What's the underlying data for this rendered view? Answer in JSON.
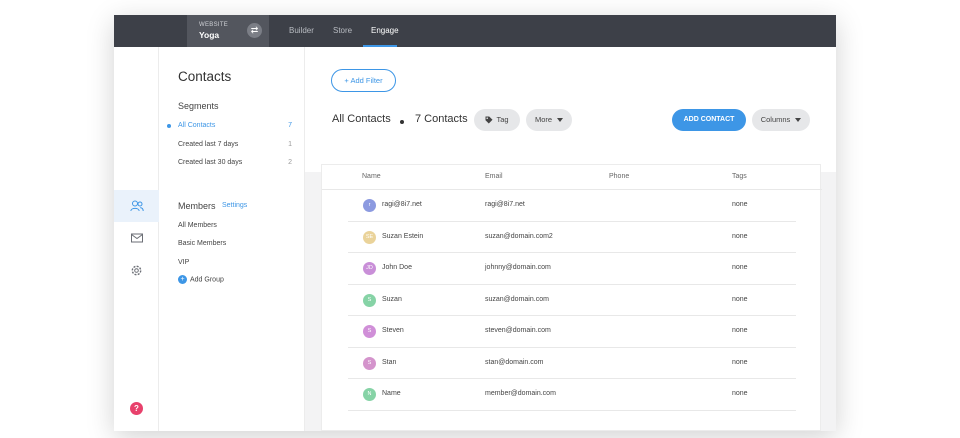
{
  "header": {
    "site_kicker": "WEBSITE",
    "site_name": "Yoga",
    "switch_icon": "swap-arrows-icon",
    "tabs": [
      {
        "label": "Builder",
        "active": false
      },
      {
        "label": "Store",
        "active": false
      },
      {
        "label": "Engage",
        "active": true
      }
    ]
  },
  "rail": {
    "items": [
      {
        "icon": "contacts-icon",
        "active": true
      },
      {
        "icon": "mail-icon",
        "active": false
      },
      {
        "icon": "gear-icon",
        "active": false
      }
    ],
    "help_label": "?"
  },
  "sidebar": {
    "title": "Contacts",
    "segments_heading": "Segments",
    "segments": [
      {
        "label": "All Contacts",
        "count": "7",
        "active": true
      },
      {
        "label": "Created last 7 days",
        "count": "1",
        "active": false
      },
      {
        "label": "Created last 30 days",
        "count": "2",
        "active": false
      }
    ],
    "members_heading": "Members",
    "settings_label": "Settings",
    "members": [
      {
        "label": "All Members"
      },
      {
        "label": "Basic Members"
      },
      {
        "label": "VIP"
      }
    ],
    "add_group_label": "Add Group"
  },
  "main": {
    "add_filter_label": "+ Add Filter",
    "heading": "All Contacts",
    "count_label": "7 Contacts",
    "tag_label": "Tag",
    "more_label": "More",
    "add_contact_label": "ADD CONTACT",
    "columns_label": "Columns"
  },
  "table": {
    "headers": [
      "Name",
      "Email",
      "Phone",
      "Tags"
    ],
    "rows": [
      {
        "initials": "r",
        "color": "#8c9ae0",
        "name": "ragi@8i7.net",
        "email": "ragi@8i7.net",
        "phone": "",
        "tags": "none"
      },
      {
        "initials": "SE",
        "color": "#ead39a",
        "name": "Suzan Estein",
        "email": "suzan@domain.com2",
        "phone": "",
        "tags": "none"
      },
      {
        "initials": "JD",
        "color": "#c98fd8",
        "name": "John Doe",
        "email": "johnny@domain.com",
        "phone": "",
        "tags": "none"
      },
      {
        "initials": "S",
        "color": "#86d3a6",
        "name": "Suzan",
        "email": "suzan@domain.com",
        "phone": "",
        "tags": "none"
      },
      {
        "initials": "S",
        "color": "#d08fd8",
        "name": "Steven",
        "email": "steven@domain.com",
        "phone": "",
        "tags": "none"
      },
      {
        "initials": "S",
        "color": "#d494cc",
        "name": "Stan",
        "email": "stan@domain.com",
        "phone": "",
        "tags": "none"
      },
      {
        "initials": "N",
        "color": "#86d3a6",
        "name": "Name",
        "email": "member@domain.com",
        "phone": "",
        "tags": "none"
      }
    ]
  },
  "colors": {
    "accent": "#3d96e6",
    "topbar": "#3d4048",
    "help": "#e8416c"
  }
}
